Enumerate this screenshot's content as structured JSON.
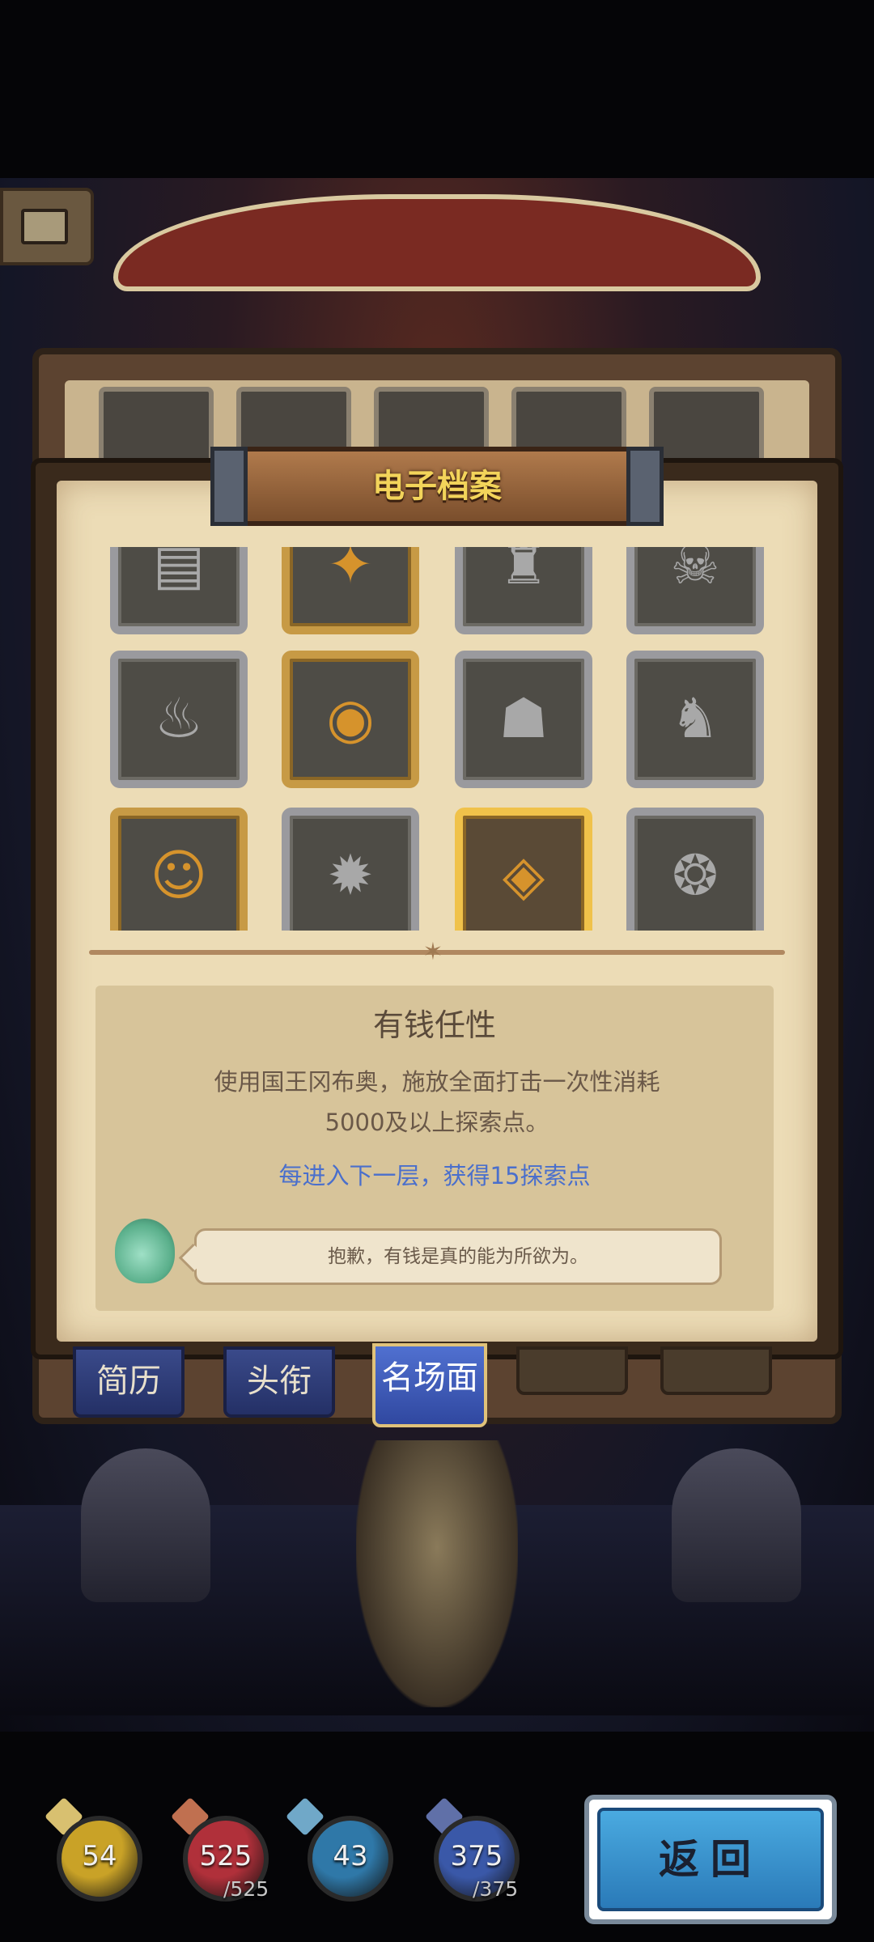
{
  "panel": {
    "title": "电子档案"
  },
  "tabs": [
    {
      "label": "简历",
      "active": false
    },
    {
      "label": "头衔",
      "active": false
    },
    {
      "label": "名场面",
      "active": true
    }
  ],
  "grid": {
    "rows": [
      [
        {
          "icon": "document-icon",
          "glyph": "▤",
          "tier": "silver"
        },
        {
          "icon": "flame-icon",
          "glyph": "✦",
          "tier": "gold"
        },
        {
          "icon": "robot-icon",
          "glyph": "♜",
          "tier": "silver"
        },
        {
          "icon": "skull-icon",
          "glyph": "☠",
          "tier": "silver"
        }
      ],
      [
        {
          "icon": "poop-icon",
          "glyph": "♨",
          "tier": "silver"
        },
        {
          "icon": "vortex-mouth-icon",
          "glyph": "◉",
          "tier": "gold"
        },
        {
          "icon": "dark-helmet-icon",
          "glyph": "☗",
          "tier": "silver"
        },
        {
          "icon": "dragon-head-icon",
          "glyph": "♞",
          "tier": "silver"
        }
      ],
      [
        {
          "icon": "chef-icon",
          "glyph": "☺",
          "tier": "gold"
        },
        {
          "icon": "spiky-blast-icon",
          "glyph": "✹",
          "tier": "silver"
        },
        {
          "icon": "gems-icon",
          "glyph": "◈",
          "tier": "gold",
          "selected": true
        },
        {
          "icon": "creature-icon",
          "glyph": "❂",
          "tier": "silver"
        }
      ]
    ]
  },
  "detail": {
    "title": "有钱任性",
    "desc_line1": "使用国王冈布奥，施放全面打击一次性消耗",
    "desc_line2": "5000及以上探索点。",
    "bonus": "每进入下一层，获得15探索点",
    "quote": "抱歉，有钱是真的能为所欲为。"
  },
  "stats": {
    "attack": {
      "value": "54",
      "color": "#c9a227"
    },
    "hp": {
      "value": "525",
      "max": "/525",
      "color": "#b0303a"
    },
    "defense": {
      "value": "43",
      "color": "#2f78a8"
    },
    "mp": {
      "value": "375",
      "max": "/375",
      "color": "#3a58a8"
    }
  },
  "back_button": {
    "label": "返回"
  }
}
